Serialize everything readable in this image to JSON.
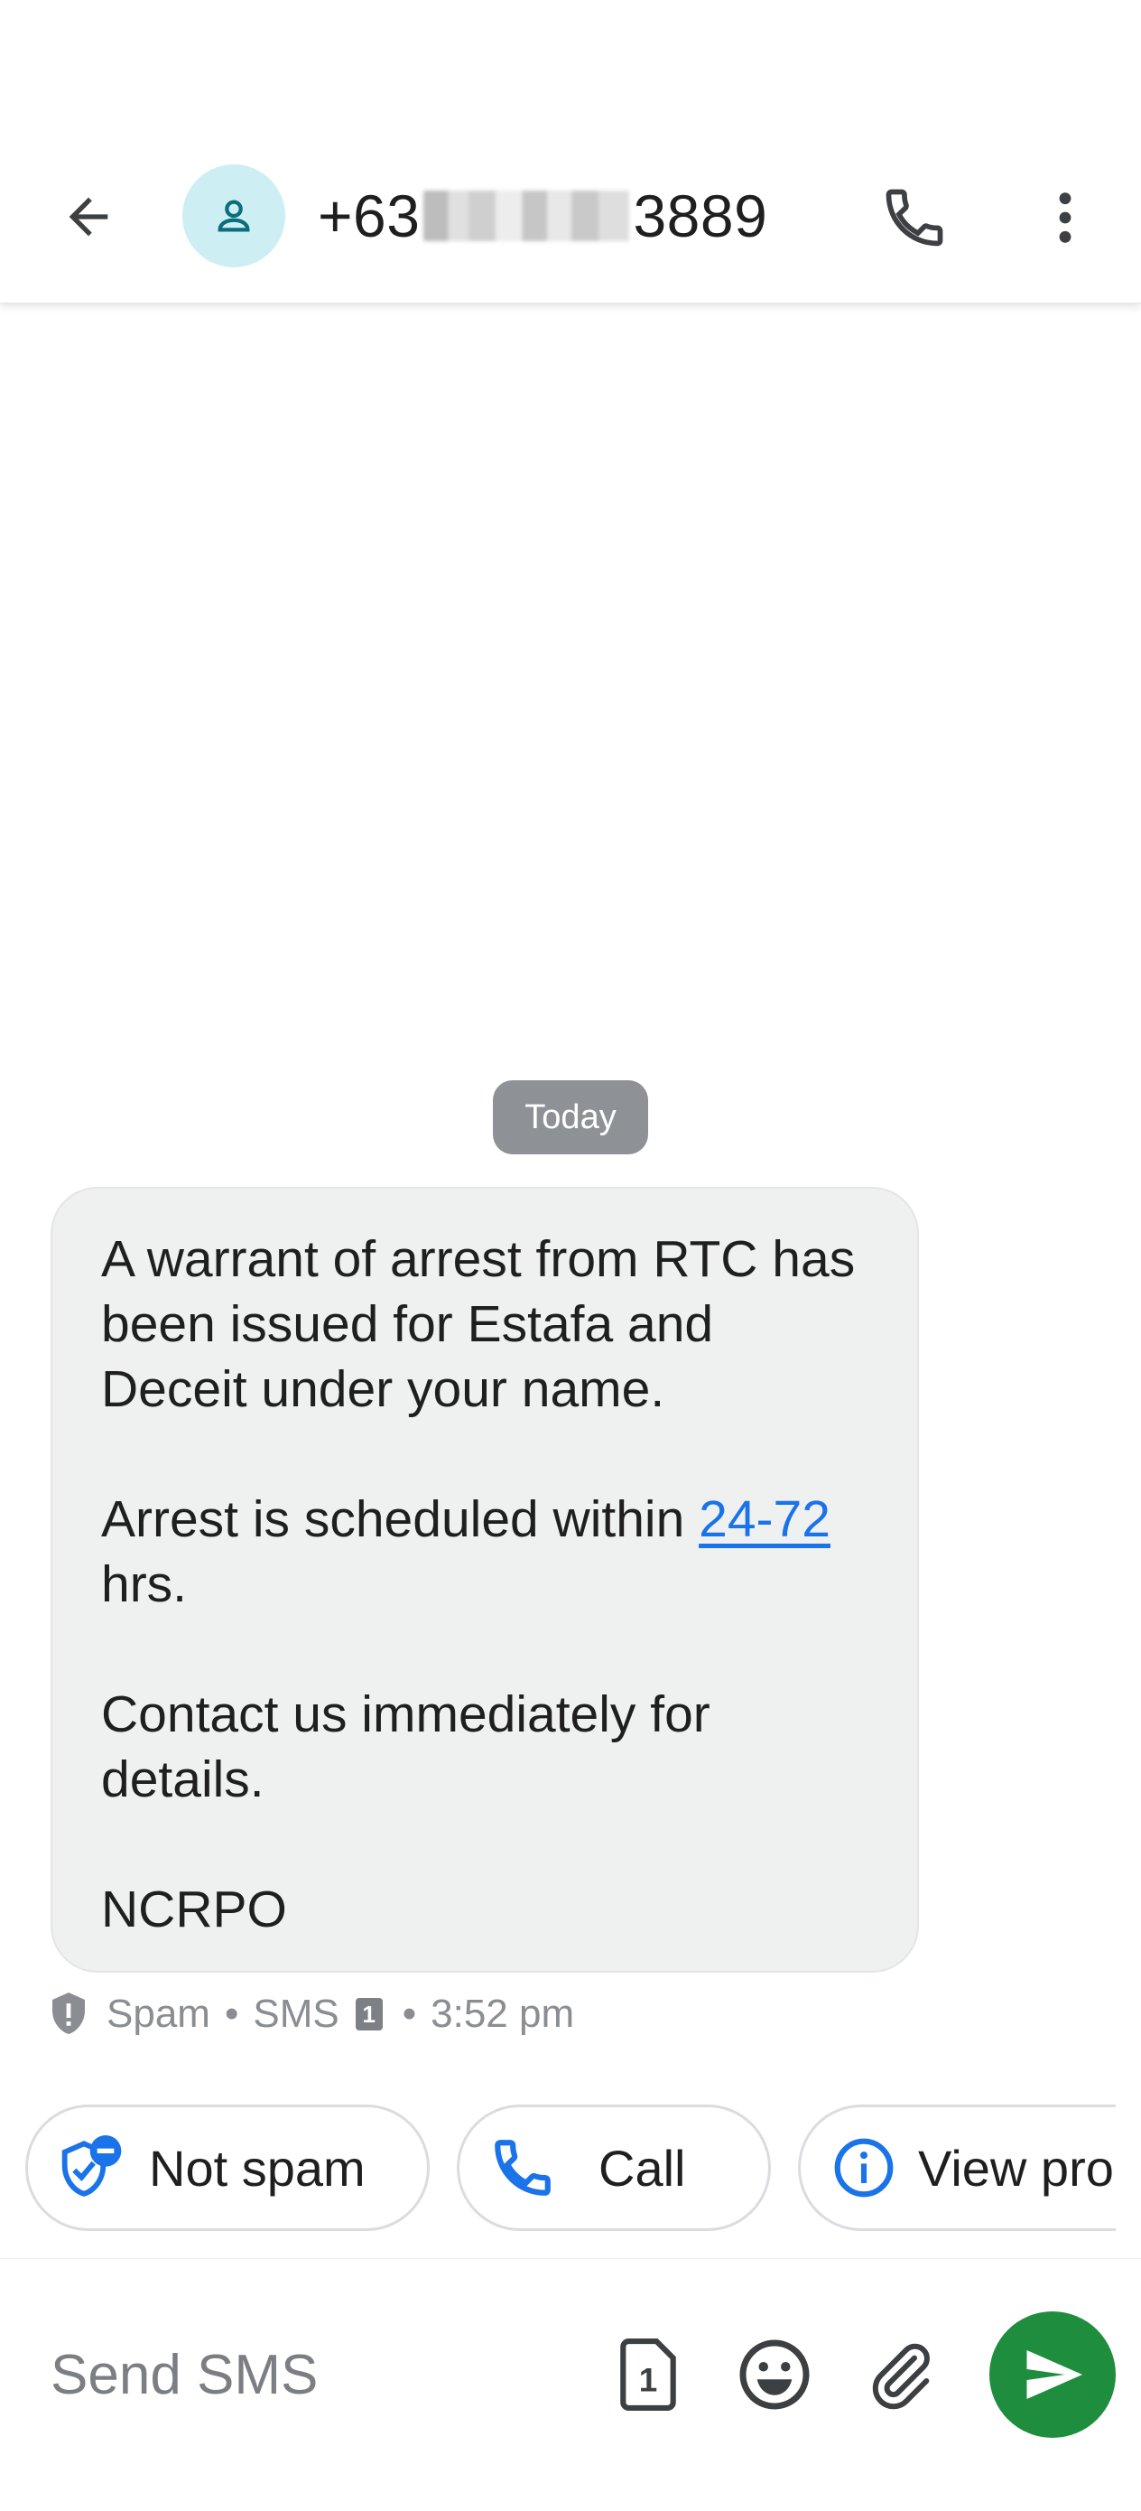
{
  "header": {
    "contact_prefix": "+63",
    "contact_suffix": "3889"
  },
  "conversation": {
    "date_chip": "Today",
    "message": {
      "paragraph_1": "A warrant of arrest from RTC has been issued for Estafa and Deceit under your name.",
      "paragraph_2_before": "Arrest is scheduled within ",
      "paragraph_2_link": "24-72",
      "paragraph_2_after": " hrs.",
      "paragraph_3": "Contact us immediately for details.",
      "paragraph_4": "NCRPO"
    },
    "meta": {
      "label": "Spam",
      "type": "SMS",
      "sim": "1",
      "time": "3:52 pm"
    }
  },
  "suggestions": [
    {
      "label": "Not spam"
    },
    {
      "label": "Call"
    },
    {
      "label": "View pro"
    }
  ],
  "compose": {
    "placeholder": "Send SMS",
    "sim_label": "1"
  },
  "colors": {
    "accent": "#1a73e8",
    "send": "#1e8e3e",
    "avatar_bg": "#cdeef3",
    "bubble_bg": "#eff0f0"
  },
  "icons": {
    "back": "arrow-back-icon",
    "avatar": "person-icon",
    "call": "phone-icon",
    "more": "more-vert-icon",
    "spam": "shield-alert-icon",
    "not_spam": "shield-minus-icon",
    "view": "info-icon",
    "sim": "sim-card-icon",
    "emoji": "emoji-icon",
    "attach": "paperclip-icon",
    "send": "send-icon"
  }
}
